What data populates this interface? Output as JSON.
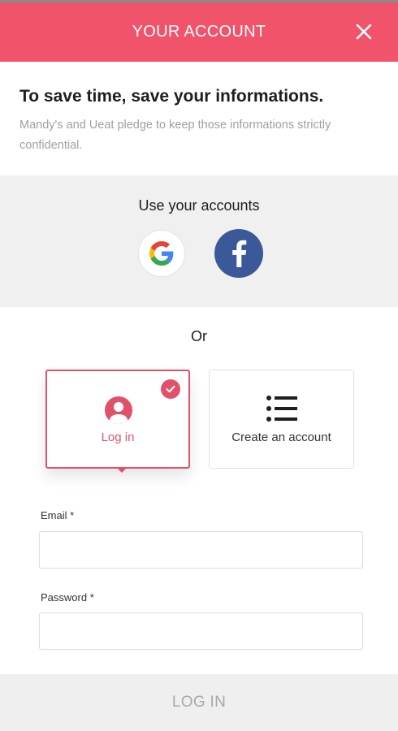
{
  "header": {
    "title": "YOUR ACCOUNT",
    "close_icon": "close-icon",
    "background": "#f0536a"
  },
  "intro": {
    "title": "To save time, save your informations.",
    "text": "Mandy's and Ueat pledge to keep those informations strictly confidential."
  },
  "social": {
    "title": "Use your accounts",
    "providers": [
      {
        "name": "Google",
        "icon": "google-icon"
      },
      {
        "name": "Facebook",
        "icon": "facebook-icon",
        "color": "#3b5998"
      }
    ]
  },
  "divider_label": "Or",
  "options": {
    "selected": "login",
    "accent": "#e0526a",
    "login": {
      "label": "Log in",
      "icon": "user-circle-icon"
    },
    "create": {
      "label": "Create an account",
      "icon": "list-icon"
    }
  },
  "form": {
    "email": {
      "label": "Email *",
      "value": "",
      "placeholder": ""
    },
    "password": {
      "label": "Password *",
      "value": "",
      "placeholder": ""
    }
  },
  "submit": {
    "label": "LOG IN",
    "enabled": false
  }
}
